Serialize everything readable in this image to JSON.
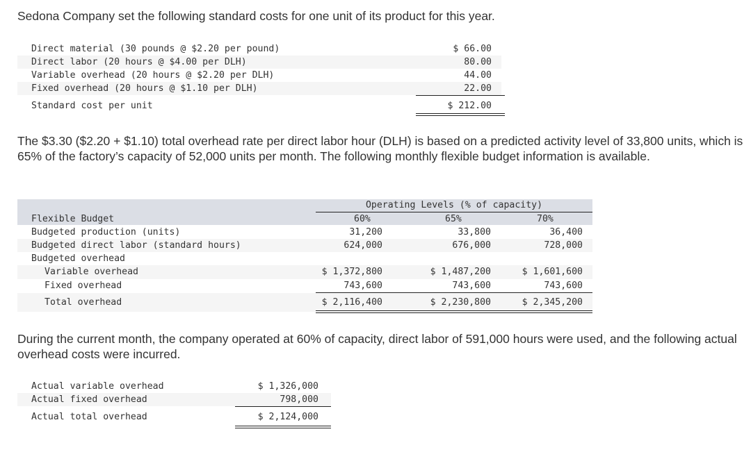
{
  "intro": "Sedona Company set the following standard costs for one unit of its product for this year.",
  "standard_costs": {
    "rows": [
      {
        "label": "Direct material (30 pounds @ $2.20 per pound)",
        "value": "$ 66.00"
      },
      {
        "label": "Direct labor (20 hours @ $4.00 per DLH)",
        "value": "80.00"
      },
      {
        "label": "Variable overhead (20 hours @ $2.20 per DLH)",
        "value": "44.00"
      },
      {
        "label": "Fixed overhead (20 hours @ $1.10 per DLH)",
        "value": "22.00"
      }
    ],
    "total": {
      "label": "Standard cost per unit",
      "value": "$ 212.00"
    }
  },
  "paragraph2": "The $3.30 ($2.20 + $1.10) total overhead rate per direct labor hour (DLH) is based on a predicted activity level of 33,800 units, which is 65% of the factory’s capacity of 52,000 units per month. The following monthly flexible budget information is available.",
  "flexible_budget": {
    "group_header": "Operating Levels (% of capacity)",
    "title": "Flexible Budget",
    "columns": [
      "60%",
      "65%",
      "70%"
    ],
    "rows": [
      {
        "label": "Budgeted production (units)",
        "values": [
          "31,200",
          "33,800",
          "36,400"
        ]
      },
      {
        "label": "Budgeted direct labor (standard hours)",
        "values": [
          "624,000",
          "676,000",
          "728,000"
        ]
      },
      {
        "label": "Budgeted overhead",
        "values": [
          "",
          "",
          ""
        ]
      },
      {
        "label": "Variable overhead",
        "values": [
          "$ 1,372,800",
          "$ 1,487,200",
          "$ 1,601,600"
        ]
      },
      {
        "label": "Fixed overhead",
        "values": [
          "743,600",
          "743,600",
          "743,600"
        ]
      },
      {
        "label": "Total overhead",
        "values": [
          "$ 2,116,400",
          "$ 2,230,800",
          "$ 2,345,200"
        ]
      }
    ]
  },
  "paragraph3": "During the current month, the company operated at 60% of capacity, direct labor of 591,000 hours were used, and the following actual overhead costs were incurred.",
  "actual_overhead": {
    "rows": [
      {
        "label": "Actual variable overhead",
        "value": "$ 1,326,000"
      },
      {
        "label": "Actual fixed overhead",
        "value": "798,000"
      }
    ],
    "total": {
      "label": "Actual total overhead",
      "value": "$ 2,124,000"
    }
  }
}
